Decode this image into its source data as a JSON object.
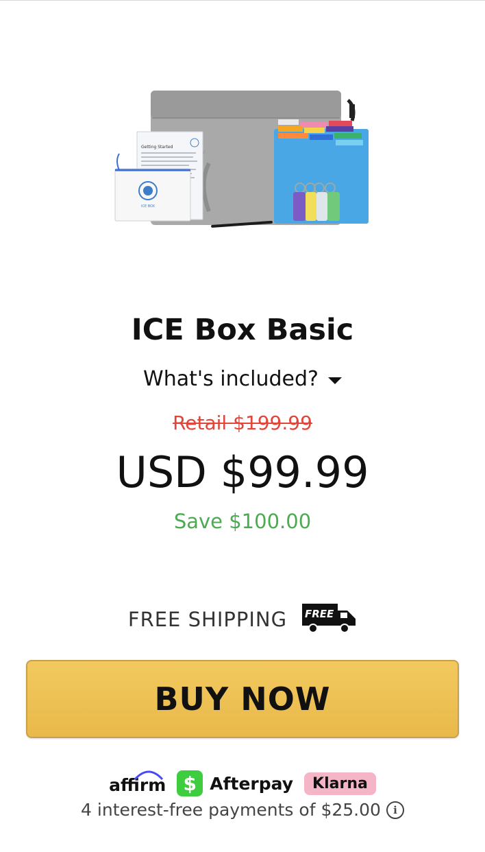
{
  "product": {
    "title": "ICE Box Basic",
    "included_label": "What's included?",
    "retail_price": "Retail $199.99",
    "price": "USD $99.99",
    "savings": "Save $100.00"
  },
  "shipping": {
    "label": "FREE SHIPPING",
    "truck_text": "FREE"
  },
  "cta": {
    "label": "BUY NOW",
    "color": "#ecbf55"
  },
  "payments": {
    "providers": [
      "affirm",
      "Afterpay",
      "Klarna"
    ],
    "cashapp_symbol": "$",
    "installments_text": "4 interest-free payments of $25.00",
    "info_symbol": "i"
  },
  "image": {
    "flyer_title": "Getting Started",
    "badge_text": "ICE BOX"
  },
  "colors": {
    "retail": "#e0463a",
    "savings": "#4caa52",
    "klarna": "#f4b6c7",
    "cashapp": "#3ecd3e"
  }
}
